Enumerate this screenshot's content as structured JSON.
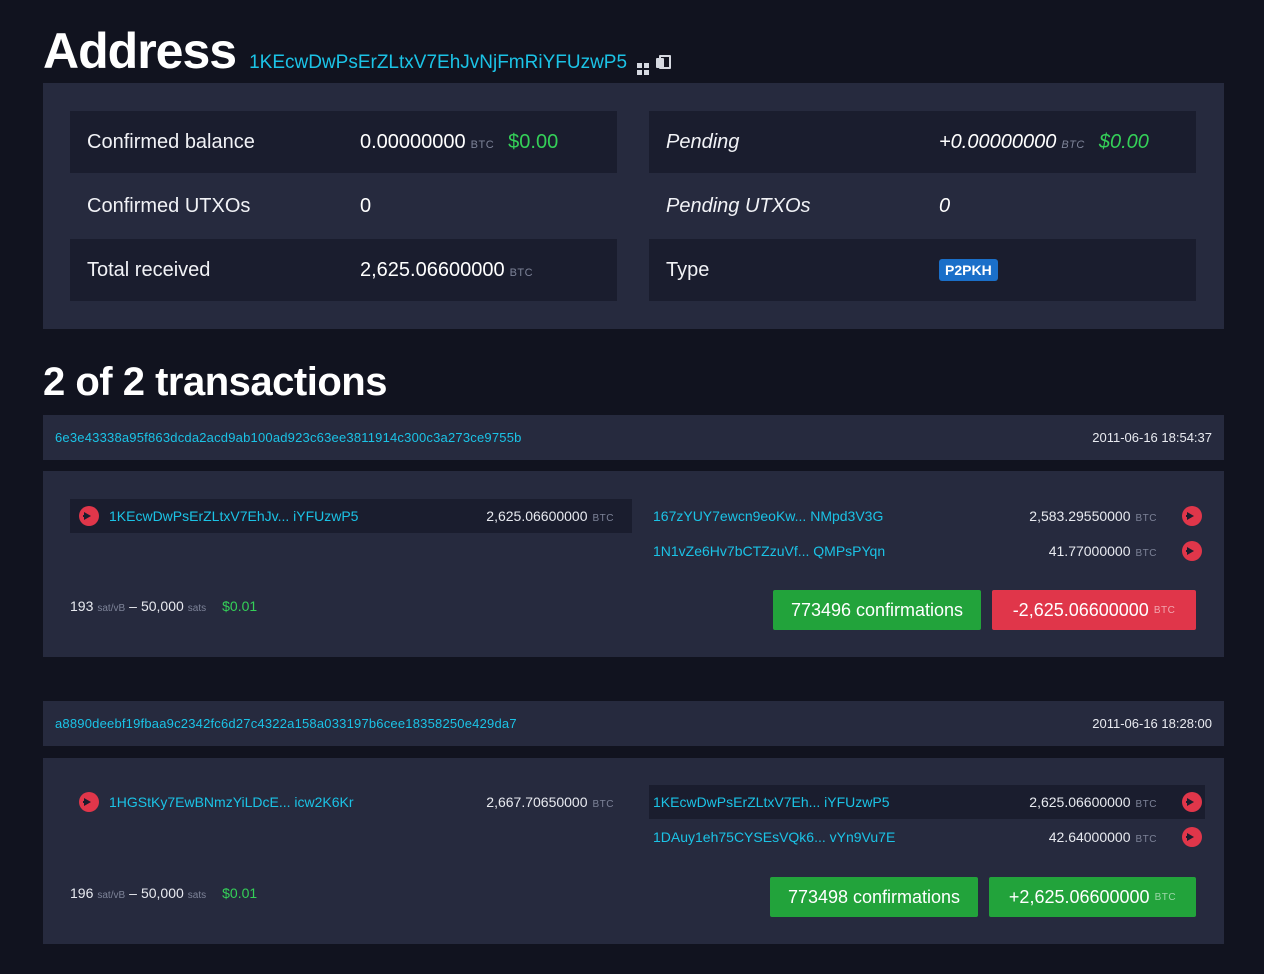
{
  "header": {
    "title": "Address",
    "address": "1KEcwDwPsErZLtxV7EhJvNjFmRiYFUzwP5"
  },
  "summary": {
    "confirmed_balance": {
      "label": "Confirmed balance",
      "value": "0.00000000",
      "unit": "BTC",
      "usd": "$0.00"
    },
    "confirmed_utxos": {
      "label": "Confirmed UTXOs",
      "value": "0"
    },
    "total_received": {
      "label": "Total received",
      "value": "2,625.06600000",
      "unit": "BTC"
    },
    "pending": {
      "label": "Pending",
      "value": "+0.00000000",
      "unit": "BTC",
      "usd": "$0.00"
    },
    "pending_utxos": {
      "label": "Pending UTXOs",
      "value": "0"
    },
    "type": {
      "label": "Type",
      "value": "P2PKH"
    }
  },
  "transactions_heading": "2 of 2 transactions",
  "transactions": [
    {
      "hash": "6e3e43338a95f863dcda2acd9ab100ad923c63ee3811914c300c3a273ce9755b",
      "time": "2011-06-16 18:54:37",
      "inputs": [
        {
          "address": "1KEcwDwPsErZLtxV7EhJv... iYFUzwP5",
          "amount": "2,625.06600000",
          "unit": "BTC"
        }
      ],
      "outputs": [
        {
          "address": "167zYUY7ewcn9eoKw... NMpd3V3G",
          "amount": "2,583.29550000",
          "unit": "BTC"
        },
        {
          "address": "1N1vZe6Hv7bCTZzuVf... QMPsPYqn",
          "amount": "41.77000000",
          "unit": "BTC"
        }
      ],
      "fee_rate": "193",
      "fee_rate_unit": "sat/vB",
      "fee_sep": "–",
      "fee": "50,000",
      "fee_unit": "sats",
      "fee_usd": "$0.01",
      "confirmations": "773496 confirmations",
      "net": "-2,625.06600000",
      "net_unit": "BTC"
    },
    {
      "hash": "a8890deebf19fbaa9c2342fc6d27c4322a158a033197b6cee18358250e429da7",
      "time": "2011-06-16 18:28:00",
      "inputs": [
        {
          "address": "1HGStKy7EwBNmzYiLDcE... icw2K6Kr",
          "amount": "2,667.70650000",
          "unit": "BTC"
        }
      ],
      "outputs": [
        {
          "address": "1KEcwDwPsErZLtxV7Eh... iYFUzwP5",
          "amount": "2,625.06600000",
          "unit": "BTC"
        },
        {
          "address": "1DAuy1eh75CYSEsVQk6... vYn9Vu7E",
          "amount": "42.64000000",
          "unit": "BTC"
        }
      ],
      "fee_rate": "196",
      "fee_rate_unit": "sat/vB",
      "fee_sep": "–",
      "fee": "50,000",
      "fee_unit": "sats",
      "fee_usd": "$0.01",
      "confirmations": "773498 confirmations",
      "net": "+2,625.06600000",
      "net_unit": "BTC"
    }
  ],
  "colors": {
    "background": "#11131f",
    "panel": "#262a3e",
    "row_shade": "#1a1d2e",
    "link": "#1bc3e6",
    "positive": "#22a33b",
    "negative": "#e0364a",
    "usd": "#34d058",
    "badge": "#1a6fc9"
  },
  "icons": [
    "qr-code-icon",
    "copy-icon",
    "arrow-right-icon"
  ]
}
